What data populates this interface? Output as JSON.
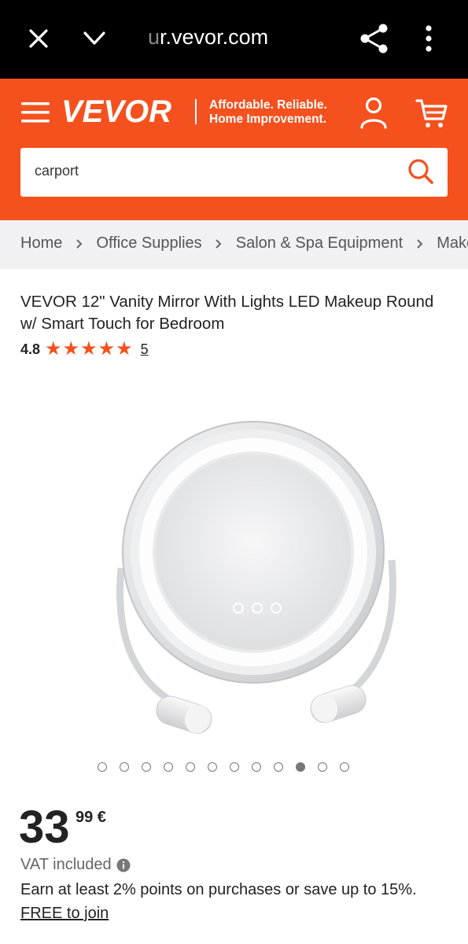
{
  "browser": {
    "url_faded": "u",
    "url": "r.vevor.com"
  },
  "header": {
    "logo": "VEVOR",
    "tagline_line1": "Affordable. Reliable.",
    "tagline_line2": "Home Improvement.",
    "brand_color": "#f4511e"
  },
  "search": {
    "value": "carport"
  },
  "breadcrumb": [
    "Home",
    "Office Supplies",
    "Salon & Spa Equipment",
    "Make"
  ],
  "product": {
    "title": "VEVOR 12\" Vanity Mirror With Lights LED Makeup Round w/ Smart Touch for Bedroom",
    "rating": "4.8",
    "stars": 5,
    "review_count": "5",
    "carousel": {
      "total": 12,
      "active_index": 9
    }
  },
  "pricing": {
    "price_int": "33",
    "price_dec": "99 €",
    "vat_text": "VAT included",
    "points_text": "Earn at least 2% points on purchases or save up to 15%.",
    "join_link": "FREE to join"
  }
}
